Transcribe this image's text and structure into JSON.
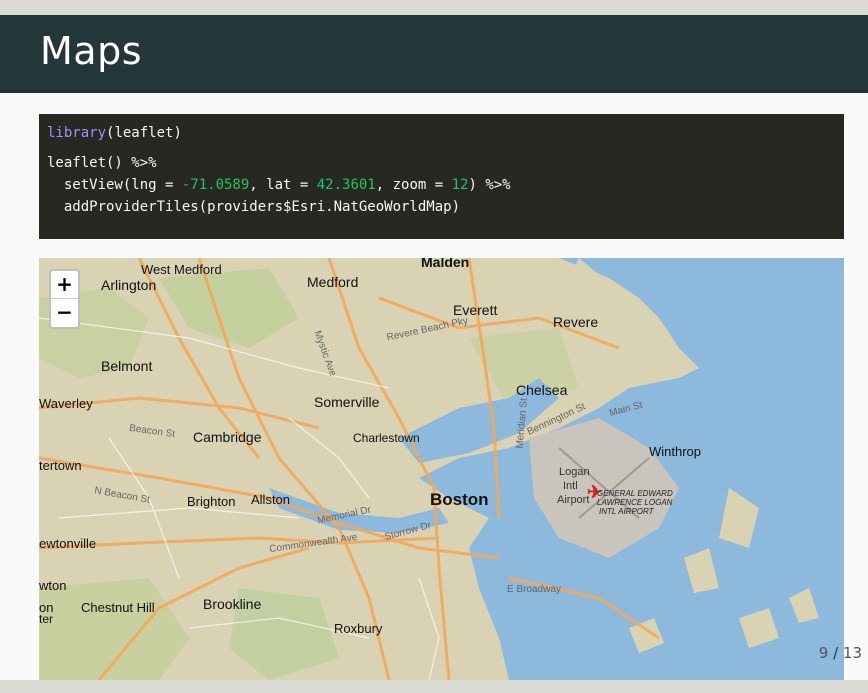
{
  "slide": {
    "title": "Maps",
    "page_current": "9",
    "page_sep": "/",
    "page_total": "13"
  },
  "code": {
    "line1_fn": "library",
    "line1_rest": "(leaflet)",
    "line2": "leaflet() %>%",
    "line3_a": "  setView(lng = ",
    "line3_lng": "-71.0589",
    "line3_b": ", lat = ",
    "line3_lat": "42.3601",
    "line3_c": ", zoom = ",
    "line3_zoom": "12",
    "line3_d": ") %>%",
    "line4": "  addProviderTiles(providers$Esri.NatGeoWorldMap)"
  },
  "map": {
    "zoom_in": "+",
    "zoom_out": "−",
    "labels": {
      "malden": "Malden",
      "west_medford": "West Medford",
      "medford": "Medford",
      "arlington": "Arlington",
      "everett": "Everett",
      "revere": "Revere",
      "belmont": "Belmont",
      "chelsea": "Chelsea",
      "waverley": "Waverley",
      "somerville": "Somerville",
      "cambridge": "Cambridge",
      "charlestown": "Charlestown",
      "winthrop": "Winthrop",
      "watertown": "tertown",
      "logan1": "Logan",
      "logan2": "Intl",
      "logan3": "Airport",
      "brighton": "Brighton",
      "allston": "Allston",
      "boston": "Boston",
      "airport1": "GENERAL EDWARD",
      "airport2": "LAWRENCE LOGAN",
      "airport3": "INTL AIRPORT",
      "newtonville": "ewtonville",
      "newton": "wton",
      "newton_c": "on",
      "newton_c2": "ter",
      "chestnut_hill": "Chestnut Hill",
      "brookline": "Brookline",
      "roxbury": "Roxbury",
      "east_broadway": "E Broadway",
      "main_st": "Main St",
      "commonwealth": "Commonwealth Ave",
      "n_beacon": "N Beacon St",
      "memorial_dr": "Memorial Dr",
      "storrow": "Storrow Dr",
      "beacon_st": "Beacon St",
      "revere_beach": "Revere Beach Pky",
      "mystic_ave": "Mystic Ave",
      "meridian_st": "Meridian St",
      "bennington": "Bennington St"
    }
  },
  "colors": {
    "header": "#23373b",
    "code_bg": "#272822",
    "water": "#8db9dd",
    "land": "#d9d3b4",
    "park": "#b9cf98",
    "road": "#f2a85a"
  }
}
